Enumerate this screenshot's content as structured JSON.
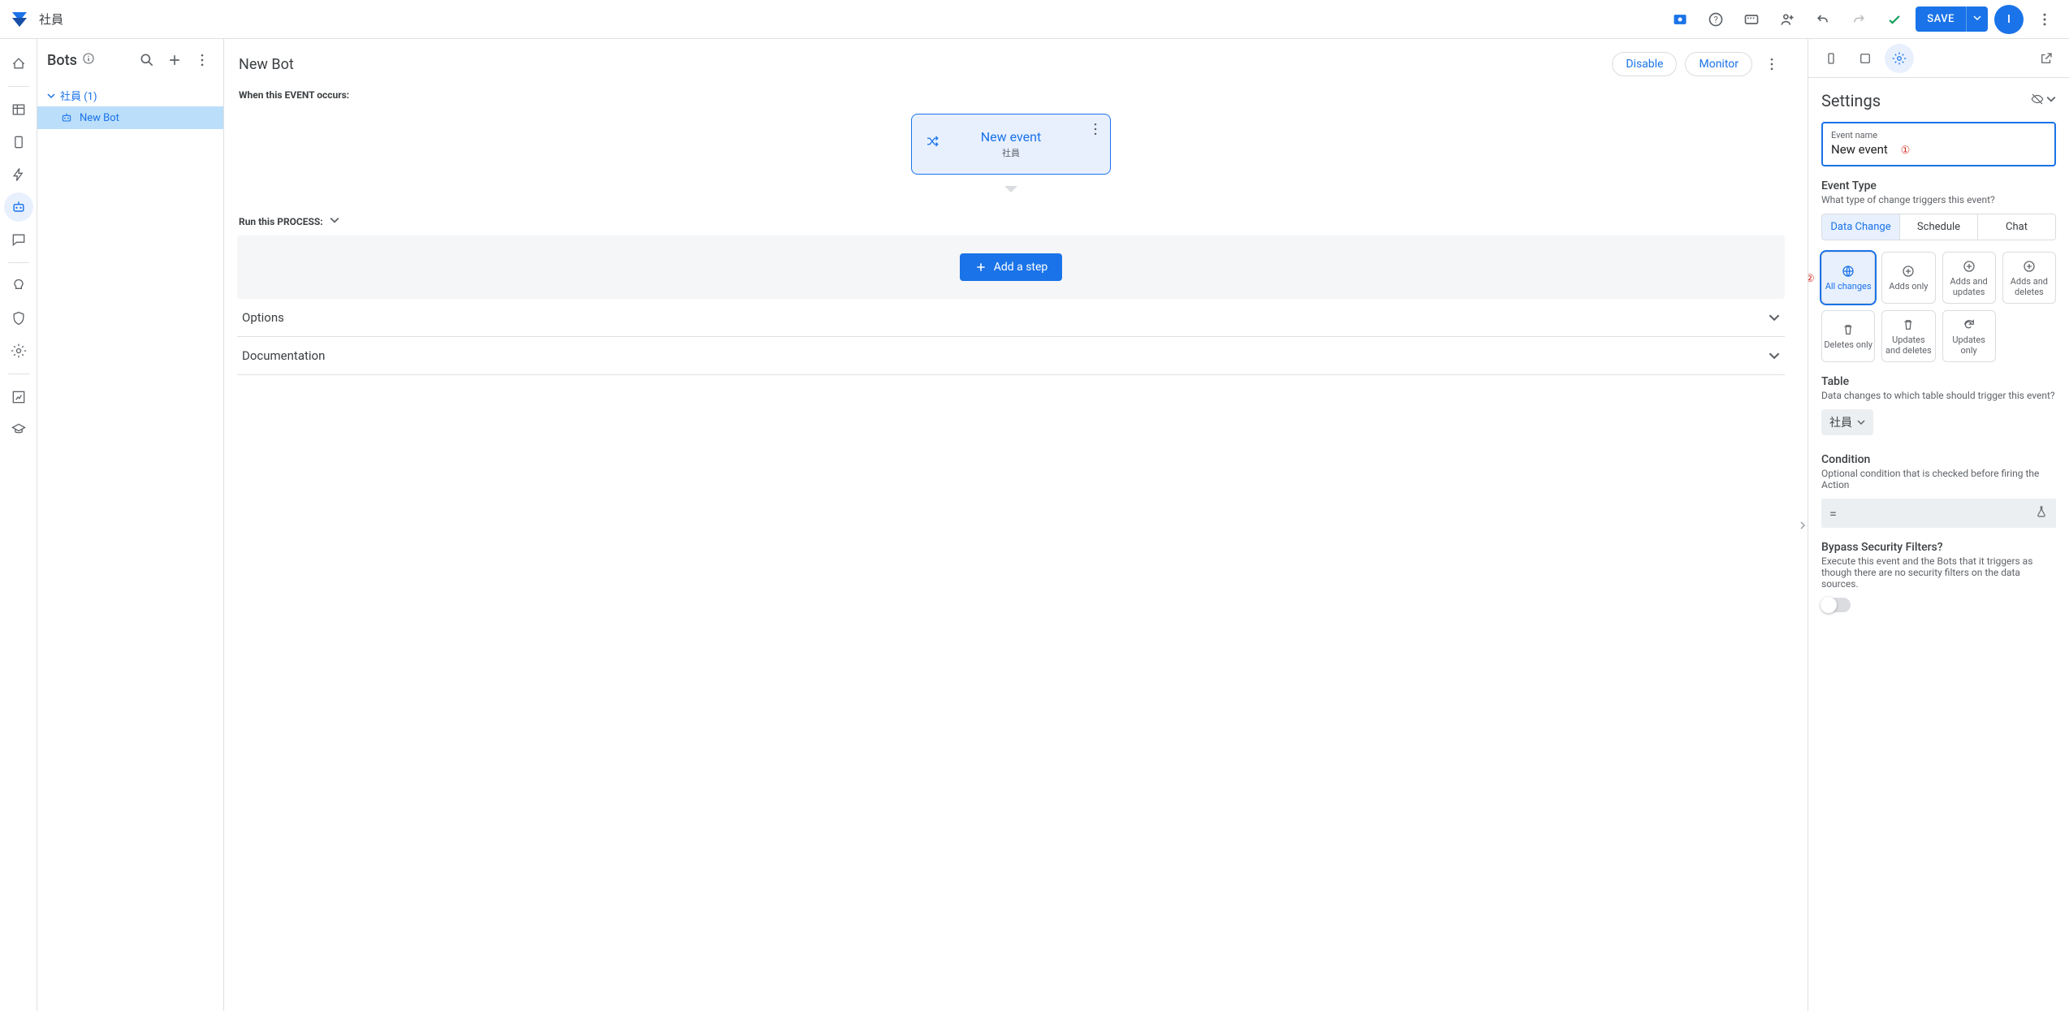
{
  "app": {
    "title": "社員",
    "avatar_initial": "I"
  },
  "topbar": {
    "save_label": "SAVE"
  },
  "sidebar": {
    "title": "Bots",
    "group_label": "社員 (1)",
    "items": [
      {
        "label": "New Bot"
      }
    ]
  },
  "canvas": {
    "title": "New Bot",
    "disable_label": "Disable",
    "monitor_label": "Monitor",
    "event_section_label": "When this EVENT occurs:",
    "event_card": {
      "title": "New event",
      "subtitle": "社員"
    },
    "process_label": "Run this PROCESS:",
    "add_step_label": "Add a step",
    "options_label": "Options",
    "documentation_label": "Documentation"
  },
  "settings": {
    "title": "Settings",
    "event_name_label": "Event name",
    "event_name_value": "New event",
    "annot1": "①",
    "annot2": "②",
    "event_type_heading": "Event Type",
    "event_type_desc": "What type of change triggers this event?",
    "seg": {
      "data_change": "Data Change",
      "schedule": "Schedule",
      "chat": "Chat"
    },
    "change_options": [
      {
        "label": "All changes"
      },
      {
        "label": "Adds only"
      },
      {
        "label": "Adds and updates"
      },
      {
        "label": "Adds and deletes"
      },
      {
        "label": "Deletes only"
      },
      {
        "label": "Updates and deletes"
      },
      {
        "label": "Updates only"
      }
    ],
    "table_heading": "Table",
    "table_desc": "Data changes to which table should trigger this event?",
    "table_value": "社員",
    "condition_heading": "Condition",
    "condition_desc": "Optional condition that is checked before firing the Action",
    "condition_value": "=",
    "bypass_heading": "Bypass Security Filters?",
    "bypass_desc": "Execute this event and the Bots that it triggers as though there are no security filters on the data sources."
  }
}
